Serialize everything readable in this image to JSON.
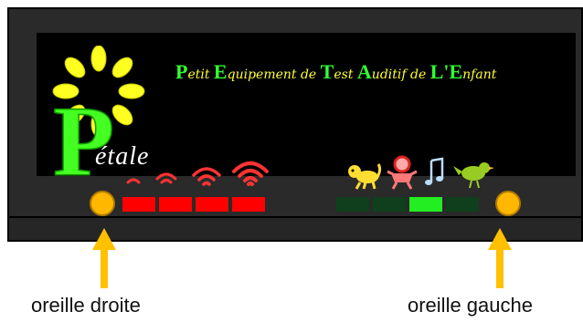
{
  "title_segments": [
    {
      "cap": "P",
      "rest": "etit "
    },
    {
      "cap": "E",
      "rest": "quipement de "
    },
    {
      "cap": "T",
      "rest": "est "
    },
    {
      "cap": "A",
      "rest": "uditif de "
    },
    {
      "cap": "L'E",
      "rest": "nfant"
    }
  ],
  "logo": {
    "big_letter": "P",
    "word": "étale"
  },
  "right_leds": {
    "count": 4,
    "lit": 4,
    "on_color": "#ff0000",
    "off_color": "#800000"
  },
  "left_leds": {
    "count": 4,
    "lit_index": 2,
    "on_color": "#22ee22",
    "off_color": "#0f3f1d"
  },
  "ear_labels": {
    "right": "oreille droite",
    "left": "oreille gauche"
  },
  "colors": {
    "accent_orange": "#ffb700",
    "wave_red": "#ff3333",
    "screen_bg": "#000000"
  },
  "icons": [
    "hearing-waves-icon",
    "monkey-icon",
    "baby-icon",
    "music-note-icon",
    "bird-icon"
  ]
}
